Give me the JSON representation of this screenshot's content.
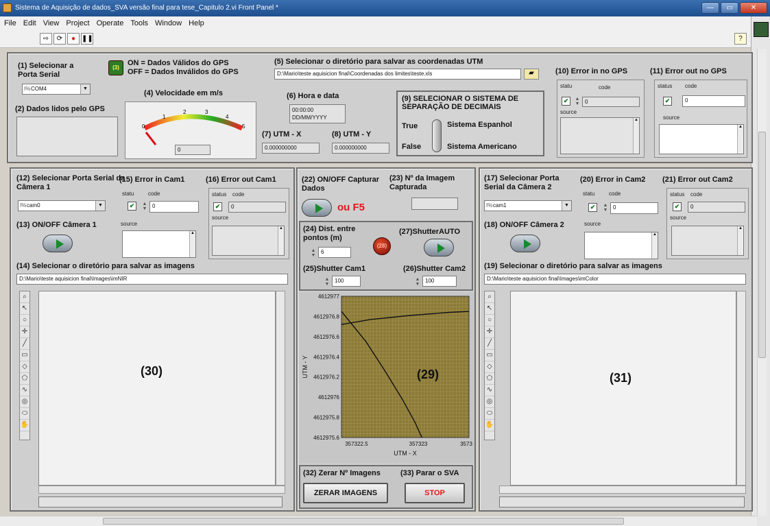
{
  "window": {
    "title": "Sistema de Aquisição de dados_SVA versão final para tese_Capitulo 2.vi Front Panel *",
    "buttons": [
      "—",
      "▭",
      "✕"
    ]
  },
  "menu": [
    "File",
    "Edit",
    "View",
    "Project",
    "Operate",
    "Tools",
    "Window",
    "Help"
  ],
  "toolbar": {
    "buttons": [
      "⇨",
      "⟳",
      "●",
      "❚❚"
    ],
    "help": "?"
  },
  "gps": {
    "port_label": "(1) Selecionar a Porta Serial",
    "port_value": "COM4",
    "port_prefix": "I%",
    "led_text": "(3)",
    "legend_on": "ON = Dados Válidos do GPS",
    "legend_off": "OFF = Dados Inválidos do GPS",
    "data_label": "(2) Dados lidos pelo GPS",
    "speed_label": "(4) Velocidade em m/s",
    "speed_value": "0",
    "gauge_ticks": [
      "0",
      "1",
      "2",
      "3",
      "4",
      "5"
    ],
    "dir_label": "(5) Selecionar o diretório para salvar as coordenadas UTM",
    "dir_value": "D:\\Mario\\teste aquisicion final\\Coordenadas dos limites\\teste.xls",
    "time_label": "(6) Hora e data",
    "time_value": "00:00:00",
    "date_value": "DD/MM/YYYY",
    "utmx_label": "(7) UTM - X",
    "utmx_value": "0.000000000",
    "utmy_label": "(8) UTM - Y",
    "utmy_value": "0.000000000",
    "decimal_label": "(9) SELECIONAR O SISTEMA DE SEPARAÇÃO DE DECIMAIS",
    "true_label": "True",
    "false_label": "False",
    "spanish_label": "Sistema Espanhol",
    "american_label": "Sistema Americano",
    "err_in_label": "(10) Error in no GPS",
    "err_out_label": "(11) Error out no GPS",
    "err_in_status": "statu",
    "err_out_status": "status",
    "code_label": "code",
    "code_value": "0",
    "source_label": "source"
  },
  "cam1": {
    "port_label": "(12) Selecionar Porta Serial da Câmera 1",
    "port_value": "cam0",
    "onoff_label": "(13) ON/OFF Câmera 1",
    "dir_label": "(14) Selecionar o diretório para salvar as imagens",
    "dir_value": "D:\\Mario\\teste aquisicion final\\Images\\imNIR",
    "err_in_label": "(15) Error in Cam1",
    "err_out_label": "(16) Error out Cam1",
    "image_id": "(30)"
  },
  "cam2": {
    "port_label": "(17) Selecionar Porta Serial da Câmera 2",
    "port_value": "cam1",
    "onoff_label": "(18) ON/OFF Câmera 2",
    "dir_label": "(19) Selecionar o diretório para salvar as imagens",
    "dir_value": "D:\\Mario\\teste aquisicion final\\Images\\imColor",
    "err_in_label": "(20) Error in Cam2",
    "err_out_label": "(21) Error out Cam2",
    "image_id": "(31)"
  },
  "center": {
    "capture_label": "(22) ON/OFF Capturar Dados",
    "or_f5": "ou F5",
    "img_count_label": "(23) Nº da Imagem Capturada",
    "dist_label": "(24) Dist. entre pontos (m)",
    "dist_value": "6",
    "led_text": "(28)",
    "shutter_auto_label": "(27)ShutterAUTO",
    "shutter1_label": "(25)Shutter Cam1",
    "shutter1_value": "100",
    "shutter2_label": "(26)Shutter Cam2",
    "shutter2_value": "100",
    "plot_id": "(29)",
    "zero_label": "(32) Zerar Nº Imagens",
    "zero_button": "ZERAR IMAGENS",
    "stop_label": "(33) Parar o SVA",
    "stop_button": "STOP"
  },
  "chart_data": {
    "type": "line",
    "xlabel": "UTM - X",
    "ylabel": "UTM - Y",
    "x_ticks": [
      "357322.5",
      "357323",
      "3573"
    ],
    "y_ticks": [
      "4612977",
      "4612976.8",
      "4612976.6",
      "4612976.4",
      "4612976.2",
      "4612976",
      "4612975.8",
      "4612975.6"
    ],
    "xlim": [
      357322.3,
      357323.6
    ],
    "ylim": [
      4612975.6,
      4612977
    ],
    "grid": true,
    "series": [
      {
        "x": [
          357322.3,
          357322.6,
          357323.0,
          357323.4,
          357323.6
        ],
        "y": [
          4612976.72,
          4612976.77,
          4612976.81,
          4612976.84,
          4612976.85
        ]
      },
      {
        "x": [
          357322.3,
          357322.55,
          357322.75,
          357322.92,
          357323.05,
          357323.12
        ],
        "y": [
          4612976.85,
          4612976.55,
          4612976.25,
          4612975.98,
          4612975.75,
          4612975.6
        ]
      }
    ]
  },
  "icons": {
    "image_tools": [
      "zoom-icon",
      "arrow-icon",
      "circle-icon",
      "crosshair-icon",
      "line-icon",
      "rect-icon",
      "rotated-rect-icon",
      "polygon-icon",
      "freehand-icon",
      "annulus-icon",
      "oval-icon",
      "pan-icon"
    ]
  }
}
